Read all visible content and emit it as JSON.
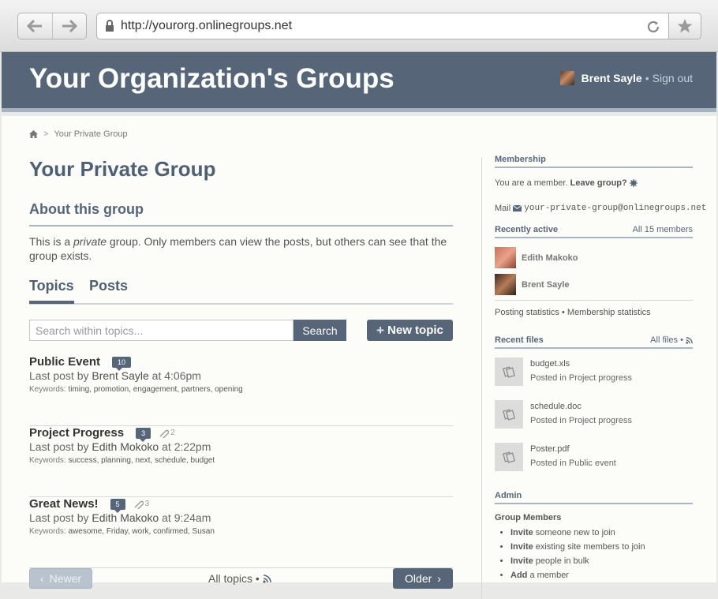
{
  "browser": {
    "url": "http://yourorg.onlinegroups.net",
    "icons": {
      "back": "back-arrow-icon",
      "forward": "forward-arrow-icon",
      "lock": "lock-icon",
      "reload": "reload-icon",
      "star": "star-icon"
    }
  },
  "header": {
    "site_title": "Your Organization's Groups",
    "user_name": "Brent Sayle",
    "separator": "•",
    "sign_out": "Sign out"
  },
  "breadcrumb": {
    "current": "Your Private Group",
    "separator": ">"
  },
  "group": {
    "title": "Your Private Group",
    "about_heading": "About this group",
    "about_text": {
      "part1": "This is a ",
      "emphasis": "private",
      "part2": " group. Only members can view the posts, but others can see that the group exists."
    }
  },
  "tabs": [
    {
      "label": "Topics",
      "active": true
    },
    {
      "label": "Posts",
      "active": false
    }
  ],
  "search": {
    "placeholder": "Search within topics...",
    "button_label": "Search"
  },
  "new_topic": {
    "plus": "+",
    "label": "New topic"
  },
  "topics": [
    {
      "title": "Public Event",
      "post_count": "10",
      "attachments": "",
      "last_post_prefix": "Last post by",
      "author": "Brent Sayle",
      "at": "at",
      "time": "4:06pm",
      "keywords_label": "Keywords:",
      "keywords": "timing, promotion, engagement, partners, opening"
    },
    {
      "title": "Project Progress",
      "post_count": "3",
      "attachments": "2",
      "last_post_prefix": "Last post by",
      "author": "Edith Mokoko",
      "at": "at",
      "time": "2:22pm",
      "keywords_label": "Keywords:",
      "keywords": "success, planning, next, schedule, budget"
    },
    {
      "title": "Great News!",
      "post_count": "5",
      "attachments": "3",
      "last_post_prefix": "Last post by",
      "author": "Edith Makoko",
      "at": "at",
      "time": "9:24am",
      "keywords_label": "Keywords:",
      "keywords": "awesome, Friday, work, confirmed, Susan"
    }
  ],
  "pager": {
    "newer": "Newer",
    "all_topics": "All topics",
    "bullet": "•",
    "older": "Older"
  },
  "sidebar": {
    "membership": {
      "heading": "Membership",
      "status": "You are a member.",
      "leave": "Leave group?",
      "mail_label": "Mail",
      "mail_address": "your-private-group@onlinegroups.net"
    },
    "recently_active": {
      "heading": "Recently active",
      "all_members": "All 15 members",
      "members": [
        "Edith Makoko",
        "Brent Sayle"
      ]
    },
    "stats": {
      "posting": "Posting statistics",
      "bullet": "•",
      "membership": "Membership statistics"
    },
    "recent_files": {
      "heading": "Recent files",
      "all_files": "All files",
      "bullet": "•",
      "posted_in": "Posted in",
      "files": [
        {
          "name": "budget.xls",
          "topic": "Project progress"
        },
        {
          "name": "schedule.doc",
          "topic": "Project progress"
        },
        {
          "name": "Poster.pdf",
          "topic": "Public event"
        }
      ]
    },
    "admin": {
      "heading": "Admin",
      "subheading": "Group Members",
      "items": [
        {
          "verb": "Invite",
          "rest": "someone new to join"
        },
        {
          "verb": "Invite",
          "rest": "existing site members to join"
        },
        {
          "verb": "Invite",
          "rest": "people in bulk"
        },
        {
          "verb": "Add",
          "rest": "a member"
        }
      ]
    }
  },
  "colors": {
    "header_bg": "#566678",
    "accent": "#566678",
    "page_bg": "#fcfcf9"
  }
}
